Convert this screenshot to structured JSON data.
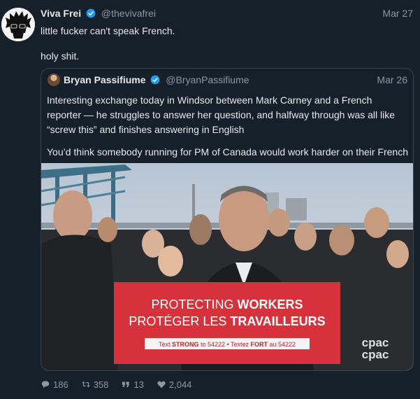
{
  "tweet": {
    "author_name": "Viva Frei",
    "author_handle": "@thevivafrei",
    "date": "Mar 27",
    "lines": [
      "little fucker can't speak French.",
      "holy shit."
    ]
  },
  "quote": {
    "author_name": "Bryan Passifiume",
    "author_handle": "@BryanPassifiume",
    "date": "Mar 26",
    "lines": [
      "Interesting exchange today in Windsor between Mark Carney and a French",
      "reporter — he struggles to answer her question, and halfway through was all like",
      "“screw this” and finishes answering in English",
      "You’d think somebody running for PM of Canada would work harder on their French"
    ],
    "media": {
      "sign_line1_a": "PROTECTING ",
      "sign_line1_b": "WORKERS",
      "sign_line2_a": "PROTÉGER LES ",
      "sign_line2_b": "TRAVAILLEURS",
      "sign_bar_a": "Text ",
      "sign_bar_b": "STRONG",
      "sign_bar_c": " to 54222 • Textez ",
      "sign_bar_d": "FORT",
      "sign_bar_e": " au 54222",
      "watermark_1": "cpac",
      "watermark_2": "cpac"
    }
  },
  "actions": {
    "replies": "186",
    "retweets": "358",
    "quotes": "13",
    "likes": "2,044"
  },
  "colors": {
    "background": "#15202b",
    "verified": "#1d9bf0",
    "sign_red": "#d7323c"
  },
  "icons": [
    "reply-icon",
    "retweet-icon",
    "quote-icon",
    "like-icon",
    "verified-icon"
  ]
}
